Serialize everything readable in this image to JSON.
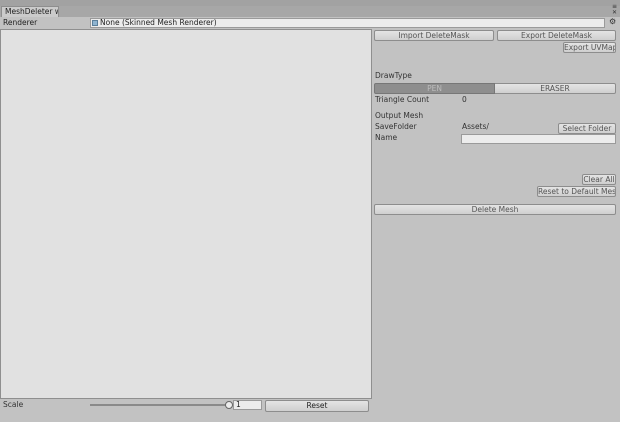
{
  "window": {
    "tab_title": "MeshDeleter wi",
    "window_buttons": [
      "≡",
      "✕"
    ]
  },
  "renderer": {
    "label": "Renderer",
    "value": "None (Skinned Mesh Renderer)"
  },
  "buttons": {
    "import_mask": "Import DeleteMask",
    "export_mask": "Export DeleteMask",
    "export_uvmap": "Export UVMap",
    "select_folder": "Select Folder",
    "clear_all": "Clear All",
    "reset_default": "Reset to Default Mesh",
    "delete_mesh": "Delete Mesh"
  },
  "draw_type": {
    "label": "DrawType",
    "options": [
      "PEN",
      "ERASER"
    ],
    "selected": "PEN"
  },
  "triangle_count": {
    "label": "Triangle Count",
    "value": "0"
  },
  "output": {
    "header": "Output Mesh",
    "save_folder_label": "SaveFolder",
    "save_folder_value": "Assets/",
    "name_label": "Name",
    "name_value": ""
  },
  "footer": {
    "scale_label": "Scale",
    "scale_value": "1",
    "reset_label": "Reset"
  }
}
